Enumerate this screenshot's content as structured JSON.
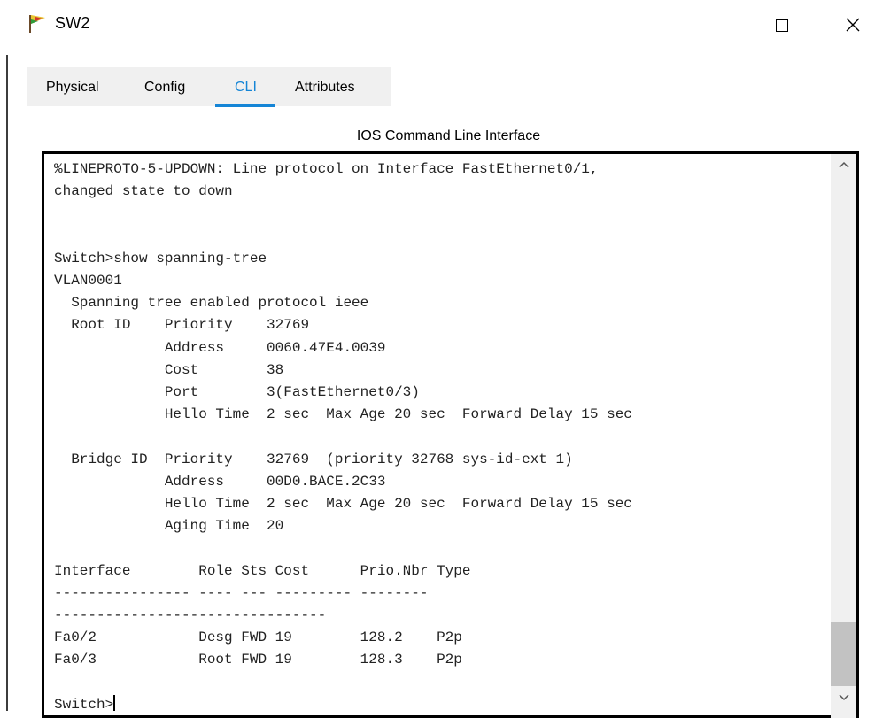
{
  "window": {
    "title": "SW2",
    "icon": "switch-app-icon",
    "controls": {
      "minimize": "minimize-icon",
      "maximize": "maximize-icon",
      "close": "close-icon"
    }
  },
  "tabs": [
    {
      "label": "Physical",
      "active": false
    },
    {
      "label": "Config",
      "active": false
    },
    {
      "label": "CLI",
      "active": true
    },
    {
      "label": "Attributes",
      "active": false
    }
  ],
  "panel": {
    "title": "IOS Command Line Interface"
  },
  "terminal": {
    "lines": [
      "%LINEPROTO-5-UPDOWN: Line protocol on Interface FastEthernet0/1,",
      "changed state to down",
      "",
      "",
      "Switch>show spanning-tree",
      "VLAN0001",
      "  Spanning tree enabled protocol ieee",
      "  Root ID    Priority    32769",
      "             Address     0060.47E4.0039",
      "             Cost        38",
      "             Port        3(FastEthernet0/3)",
      "             Hello Time  2 sec  Max Age 20 sec  Forward Delay 15 sec",
      "",
      "  Bridge ID  Priority    32769  (priority 32768 sys-id-ext 1)",
      "             Address     00D0.BACE.2C33",
      "             Hello Time  2 sec  Max Age 20 sec  Forward Delay 15 sec",
      "             Aging Time  20",
      "",
      "Interface        Role Sts Cost      Prio.Nbr Type",
      "---------------- ---- --- --------- --------",
      "--------------------------------",
      "Fa0/2            Desg FWD 19        128.2    P2p",
      "Fa0/3            Root FWD 19        128.3    P2p",
      ""
    ],
    "prompt": "Switch>"
  },
  "colors": {
    "accent": "#1585d6",
    "tabbar_bg": "#f0f0f0",
    "terminal_border": "#000000",
    "scroll_thumb": "#c2c2c2"
  }
}
